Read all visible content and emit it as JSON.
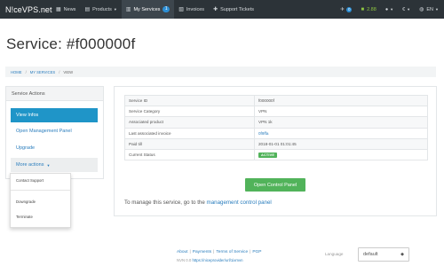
{
  "brand": "N!ceVPS.net",
  "nav": {
    "news": "News",
    "products": "Products",
    "my_services": "My Services",
    "my_services_count": "1",
    "invoices": "Invoices",
    "support": "Support Tickets"
  },
  "nav_right": {
    "notifications_count": "0",
    "credits": "2.88",
    "currency": "€",
    "language": "EN"
  },
  "page_title": "Service: #f000000f",
  "breadcrumb": [
    "HOME",
    "MY SERVICES",
    "VIEW"
  ],
  "sidebar": {
    "heading": "Service Actions",
    "items": [
      "View Infos",
      "Open Management Panel",
      "Upgrade",
      "More actions"
    ]
  },
  "dropdown": {
    "items": [
      "Contact Support",
      "Downgrade",
      "Terminate"
    ]
  },
  "info_table": [
    {
      "label": "Service ID",
      "value": "f000000f"
    },
    {
      "label": "Service Category",
      "value": "VPN"
    },
    {
      "label": "Associated product",
      "value": "VPN 1k"
    },
    {
      "label": "Last associated invoice",
      "value": "0f9ffa"
    },
    {
      "label": "Paid till",
      "value": "2018-01-01 01:01:45"
    },
    {
      "label": "Current Status",
      "value": "ACTIVE"
    }
  ],
  "open_button": "Open Control Panel",
  "manage_text": {
    "prefix": "To manage this service, go to the",
    "link": "management control panel"
  },
  "footer": {
    "links": [
      "About",
      "Payments",
      "Terms of Service",
      "PGP"
    ],
    "copyright_prefix": "NVN 0.0",
    "copyright_link": "https://niceprovider/url/1ixmvn"
  },
  "language_select": {
    "label": "Language",
    "value": "default"
  },
  "colors": {
    "navbar": "#2c3338",
    "accent": "#1f95c8",
    "success": "#51b35a",
    "link": "#2a7dbd"
  }
}
